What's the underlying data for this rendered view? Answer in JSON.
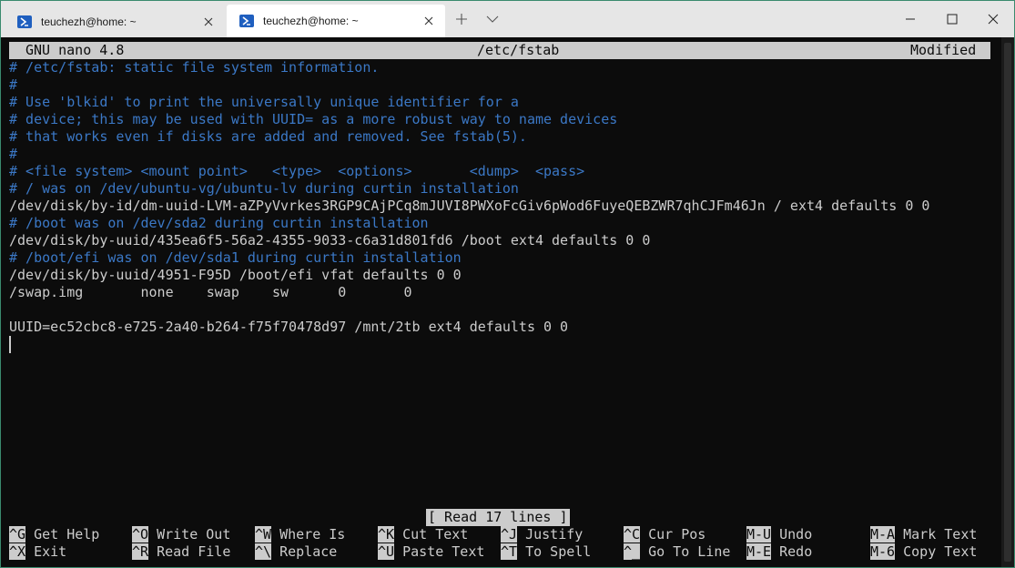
{
  "tabs": [
    {
      "label": "teuchezh@home: ~",
      "active": false
    },
    {
      "label": "teuchezh@home: ~",
      "active": true
    }
  ],
  "nano": {
    "version": "GNU nano 4.8",
    "filename": "/etc/fstab",
    "state": "Modified"
  },
  "file_lines": [
    {
      "text": "# /etc/fstab: static file system information.",
      "comment": true
    },
    {
      "text": "#",
      "comment": true
    },
    {
      "text": "# Use 'blkid' to print the universally unique identifier for a",
      "comment": true
    },
    {
      "text": "# device; this may be used with UUID= as a more robust way to name devices",
      "comment": true
    },
    {
      "text": "# that works even if disks are added and removed. See fstab(5).",
      "comment": true
    },
    {
      "text": "#",
      "comment": true
    },
    {
      "text": "# <file system> <mount point>   <type>  <options>       <dump>  <pass>",
      "comment": true
    },
    {
      "text": "# / was on /dev/ubuntu-vg/ubuntu-lv during curtin installation",
      "comment": true
    },
    {
      "text": "/dev/disk/by-id/dm-uuid-LVM-aZPyVvrkes3RGP9CAjPCq8mJUVI8PWXoFcGiv6pWod6FuyeQEBZWR7qhCJFm46Jn / ext4 defaults 0 0",
      "comment": false
    },
    {
      "text": "# /boot was on /dev/sda2 during curtin installation",
      "comment": true
    },
    {
      "text": "/dev/disk/by-uuid/435ea6f5-56a2-4355-9033-c6a31d801fd6 /boot ext4 defaults 0 0",
      "comment": false
    },
    {
      "text": "# /boot/efi was on /dev/sda1 during curtin installation",
      "comment": true
    },
    {
      "text": "/dev/disk/by-uuid/4951-F95D /boot/efi vfat defaults 0 0",
      "comment": false
    },
    {
      "text": "/swap.img       none    swap    sw      0       0",
      "comment": false
    },
    {
      "text": "",
      "comment": false
    },
    {
      "text": "UUID=ec52cbc8-e725-2a40-b264-f75f70478d97 /mnt/2tb ext4 defaults 0 0",
      "comment": false
    }
  ],
  "status_message": "[ Read 17 lines ]",
  "shortcuts": [
    [
      {
        "key": "^G",
        "label": "Get Help"
      },
      {
        "key": "^O",
        "label": "Write Out"
      },
      {
        "key": "^W",
        "label": "Where Is"
      },
      {
        "key": "^K",
        "label": "Cut Text"
      },
      {
        "key": "^J",
        "label": "Justify"
      },
      {
        "key": "^C",
        "label": "Cur Pos"
      },
      {
        "key": "M-U",
        "label": "Undo"
      },
      {
        "key": "M-A",
        "label": "Mark Text"
      }
    ],
    [
      {
        "key": "^X",
        "label": "Exit"
      },
      {
        "key": "^R",
        "label": "Read File"
      },
      {
        "key": "^\\",
        "label": "Replace"
      },
      {
        "key": "^U",
        "label": "Paste Text"
      },
      {
        "key": "^T",
        "label": "To Spell"
      },
      {
        "key": "^_",
        "label": "Go To Line"
      },
      {
        "key": "M-E",
        "label": "Redo"
      },
      {
        "key": "M-6",
        "label": "Copy Text"
      }
    ]
  ],
  "icons": {
    "tab_icon": "powershell-icon",
    "tab_close": "close-icon",
    "new_tab": "plus-icon",
    "dropdown": "chevron-down-icon",
    "minimize": "minimize-icon",
    "maximize": "maximize-icon",
    "close_window": "close-icon"
  },
  "colors": {
    "terminal_bg": "#0c0c0c",
    "text": "#cccccc",
    "comment": "#3b78c6",
    "inverse_bg": "#cccccc"
  }
}
